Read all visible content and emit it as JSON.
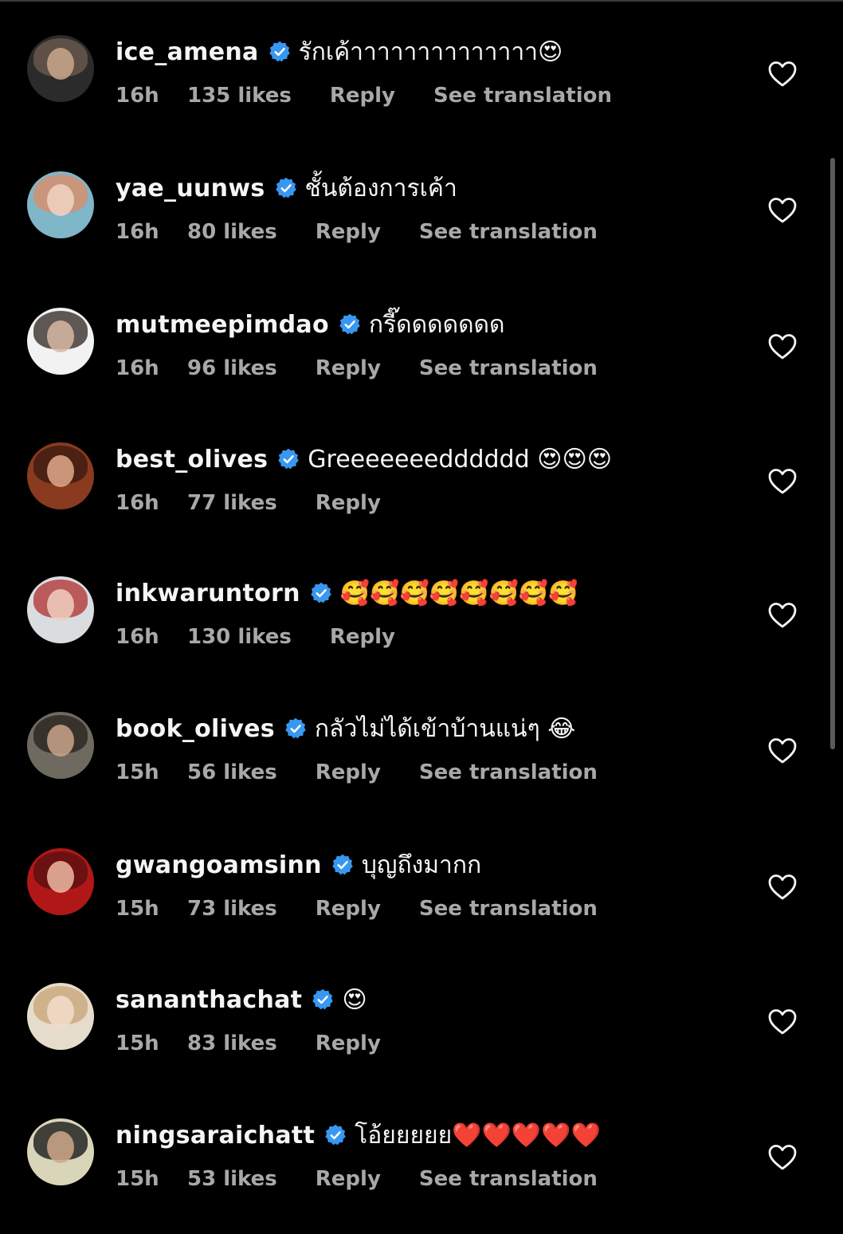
{
  "colors": {
    "background": "#000000",
    "text_primary": "#f5f5f5",
    "text_secondary": "#a8a8a8",
    "verified_badge": "#3897f0"
  },
  "icons": {
    "verified": "verified-badge-icon",
    "like": "heart-outline-icon"
  },
  "comments": [
    {
      "username": "ice_amena",
      "text": "รักเค้าาาาาาาาาาาาาา😍",
      "time": "16h",
      "likes": "135 likes",
      "reply": "Reply",
      "translation": "See translation"
    },
    {
      "username": "yae_uunws",
      "text": "ชั้นต้องการเค้า",
      "time": "16h",
      "likes": "80 likes",
      "reply": "Reply",
      "translation": "See translation"
    },
    {
      "username": "mutmeepimdao",
      "text": "กรี๊ดดดดดดด",
      "time": "16h",
      "likes": "96 likes",
      "reply": "Reply",
      "translation": "See translation"
    },
    {
      "username": "best_olives",
      "text": "Greeeeeeedddddd 😍😍😍",
      "time": "16h",
      "likes": "77 likes",
      "reply": "Reply",
      "translation": ""
    },
    {
      "username": "inkwaruntorn",
      "text": "🥰🥰🥰🥰🥰🥰🥰🥰",
      "time": "16h",
      "likes": "130 likes",
      "reply": "Reply",
      "translation": ""
    },
    {
      "username": "book_olives",
      "text": "กลัวไม่ได้เข้าบ้านแน่ๆ 😂",
      "time": "15h",
      "likes": "56 likes",
      "reply": "Reply",
      "translation": "See translation"
    },
    {
      "username": "gwangoamsinn",
      "text": "บุญถึงมากก",
      "time": "15h",
      "likes": "73 likes",
      "reply": "Reply",
      "translation": "See translation"
    },
    {
      "username": "sananthachat",
      "text": "😍",
      "time": "15h",
      "likes": "83 likes",
      "reply": "Reply",
      "translation": ""
    },
    {
      "username": "ningsaraichatt",
      "text": "โอ้ยยยยย❤️❤️❤️❤️❤️",
      "time": "15h",
      "likes": "53 likes",
      "reply": "Reply",
      "translation": "See translation"
    }
  ]
}
